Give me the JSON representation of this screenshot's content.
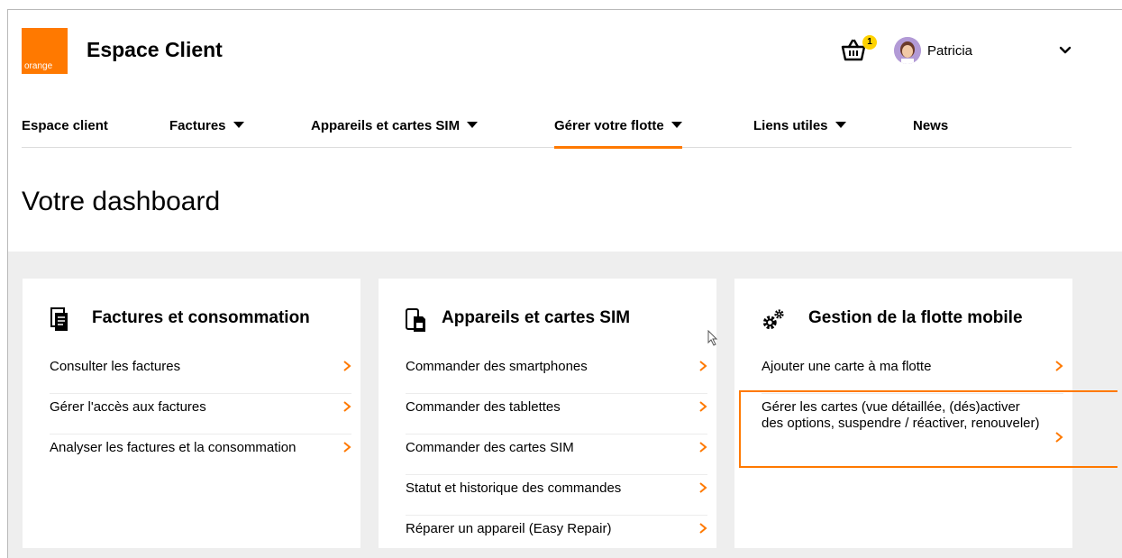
{
  "header": {
    "logo_text": "orange",
    "title": "Espace Client",
    "cart_count": "1",
    "user_name": "Patricia"
  },
  "nav": {
    "items": [
      {
        "label": "Espace client",
        "has_dropdown": false
      },
      {
        "label": "Factures",
        "has_dropdown": true
      },
      {
        "label": "Appareils et cartes SIM",
        "has_dropdown": true
      },
      {
        "label": "Gérer votre flotte",
        "has_dropdown": true,
        "active": true
      },
      {
        "label": "Liens utiles",
        "has_dropdown": true
      },
      {
        "label": "News",
        "has_dropdown": false
      }
    ]
  },
  "page": {
    "title": "Votre dashboard"
  },
  "cards": [
    {
      "icon": "invoice-icon",
      "title": "Factures et consommation",
      "links": [
        "Consulter les factures",
        "Gérer l'accès aux factures",
        "Analyser les factures et la consommation"
      ]
    },
    {
      "icon": "sim-card-icon",
      "title": "Appareils et cartes SIM",
      "links": [
        "Commander des smartphones",
        "Commander des tablettes",
        "Commander des cartes SIM",
        "Statut et historique des commandes",
        "Réparer un appareil (Easy Repair)"
      ]
    },
    {
      "icon": "gears-icon",
      "title": "Gestion de la flotte mobile",
      "links": [
        "Ajouter une carte à ma flotte",
        "Gérer les cartes (vue détaillée, (dés)activer des options, suspendre / réactiver, renouveler)"
      ]
    }
  ],
  "colors": {
    "brand": "#ff7900",
    "badge": "#ffd200",
    "content_background": "#eeeeee"
  }
}
